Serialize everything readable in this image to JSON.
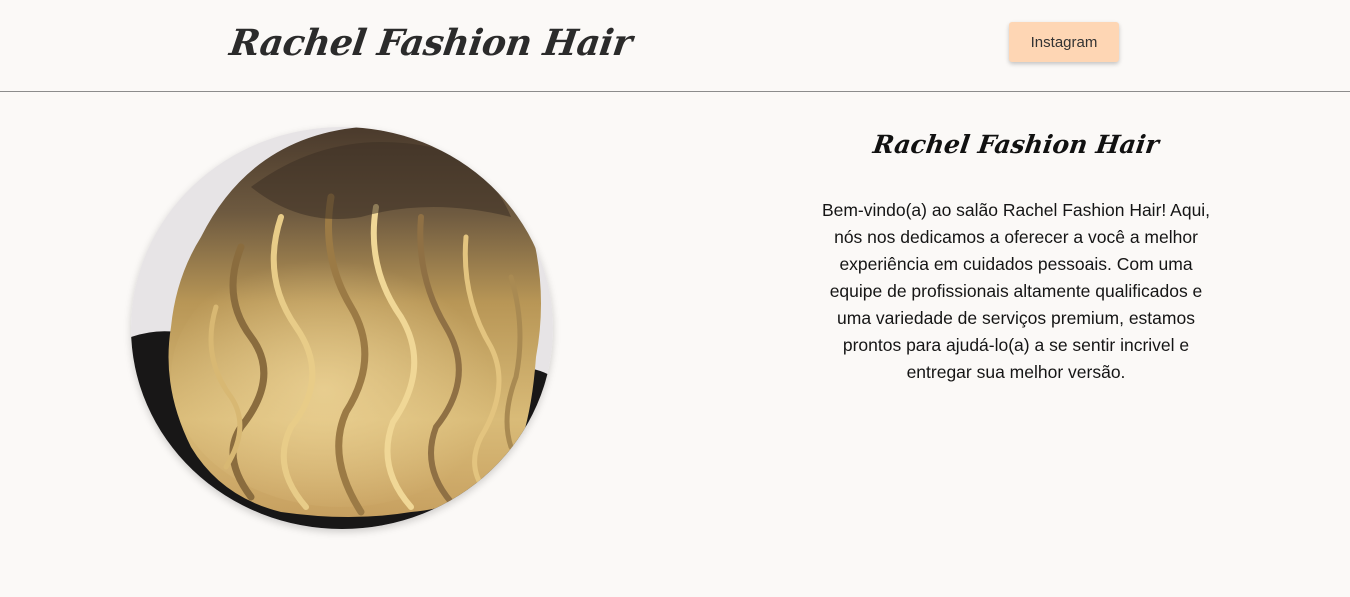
{
  "header": {
    "logo_text": "Rachel Fashion Hair",
    "instagram_label": "Instagram"
  },
  "main": {
    "title": "Rachel Fashion Hair",
    "description": "Bem-vindo(a) ao salão Rachel Fashion Hair! Aqui, nós nos dedicamos a oferecer a você a melhor experiência em cuidados pessoais. Com uma equipe de profissionais altamente qualificados e uma variedade de serviços premium, estamos prontos para ajudá-lo(a) a se sentir incrivel e entregar sua melhor versão."
  },
  "colors": {
    "background": "#fbf9f7",
    "button": "#fed6b4",
    "divider": "#8c8c8c"
  }
}
